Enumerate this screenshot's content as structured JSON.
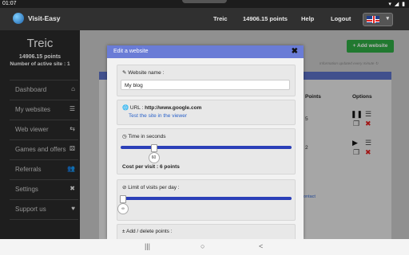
{
  "status_bar": {
    "time": "01:07",
    "icons": "▾ ◢ ▮"
  },
  "topnav": {
    "brand": "Visit-Easy",
    "username": "Treic",
    "points": "14906.15 points",
    "help": "Help",
    "logout": "Logout"
  },
  "sidebar": {
    "username": "Treic",
    "points": "14906.15 points",
    "active_sites": "Number of active site : 1",
    "items": [
      {
        "label": "Dashboard",
        "icon": "home-icon",
        "glyph": "⌂"
      },
      {
        "label": "My websites",
        "icon": "list-icon",
        "glyph": "☰"
      },
      {
        "label": "Web viewer",
        "icon": "exchange-icon",
        "glyph": "⇆"
      },
      {
        "label": "Games and offers",
        "icon": "dice-icon",
        "glyph": "⚄"
      },
      {
        "label": "Referrals",
        "icon": "users-icon",
        "glyph": "👥"
      },
      {
        "label": "Settings",
        "icon": "tools-icon",
        "glyph": "✖"
      },
      {
        "label": "Support us",
        "icon": "heart-icon",
        "glyph": "♥"
      }
    ]
  },
  "main": {
    "add_button": "+ Add website",
    "info_line": "Information updated every minute",
    "columns": {
      "points": "Points",
      "options": "Options"
    },
    "rows": [
      {
        "points": "5"
      },
      {
        "points": "2"
      }
    ],
    "contact": "Contact"
  },
  "modal": {
    "title": "Edit a website",
    "close": "✖",
    "website_name": {
      "label": "Website name :",
      "value": "My blog"
    },
    "url": {
      "label": "URL :",
      "value": "http://www.google.com",
      "test_link": "Test the site in the viewer"
    },
    "time": {
      "label": "Time in seconds",
      "value": "60",
      "fraction": 0.18,
      "cost": "Cost per visit : 6 points"
    },
    "limit": {
      "label": "Limit of visits per day :",
      "value": "∞",
      "fraction": 0.0
    },
    "points": {
      "label": "Add / delete points :"
    }
  },
  "android_nav": {
    "recents": "|||",
    "home": "○",
    "back": "<"
  },
  "colors": {
    "accent": "#6a7cd6",
    "green": "#2ea843",
    "slider": "#2b3fb8",
    "sidebar": "#2a2a2a"
  }
}
